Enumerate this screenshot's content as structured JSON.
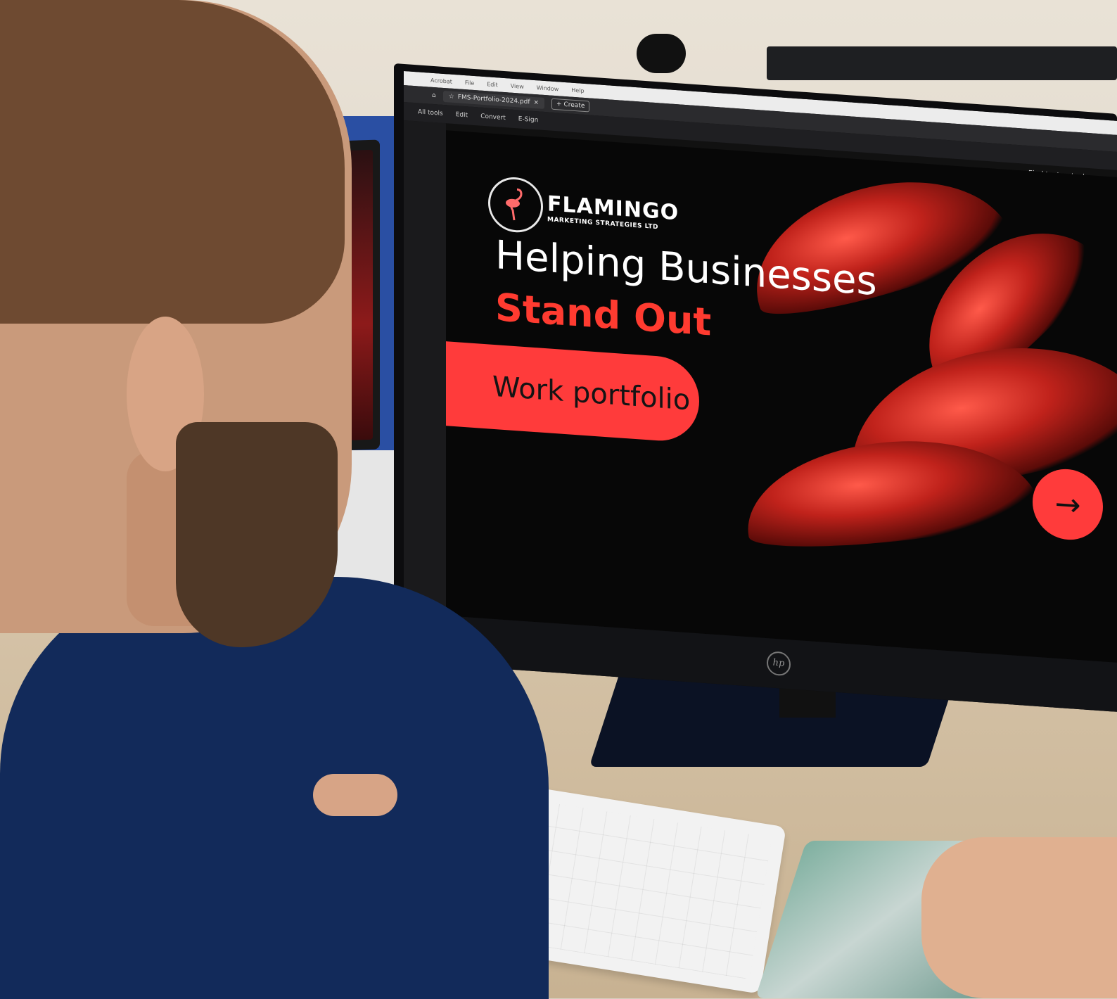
{
  "app_menu": [
    "Acrobat",
    "File",
    "Edit",
    "View",
    "Window",
    "Help"
  ],
  "tab": {
    "title": "FMS-Portfolio-2024.pdf",
    "close": "×",
    "create_label": "Create"
  },
  "toolbar": [
    "All tools",
    "Edit",
    "Convert",
    "E-Sign"
  ],
  "search": {
    "label": "Find text or tools"
  },
  "slide": {
    "brand_name": "FLAMINGO",
    "brand_tagline": "MARKETING STRATEGIES LTD",
    "headline": "Helping Businesses",
    "subline": "Stand Out",
    "cta_label": "Work portfolio",
    "next_icon": "→"
  },
  "monitor": {
    "brand": "hp"
  },
  "colors": {
    "accent": "#ff3b3b",
    "slide_bg": "#070707",
    "shirt": "#122a5a"
  }
}
